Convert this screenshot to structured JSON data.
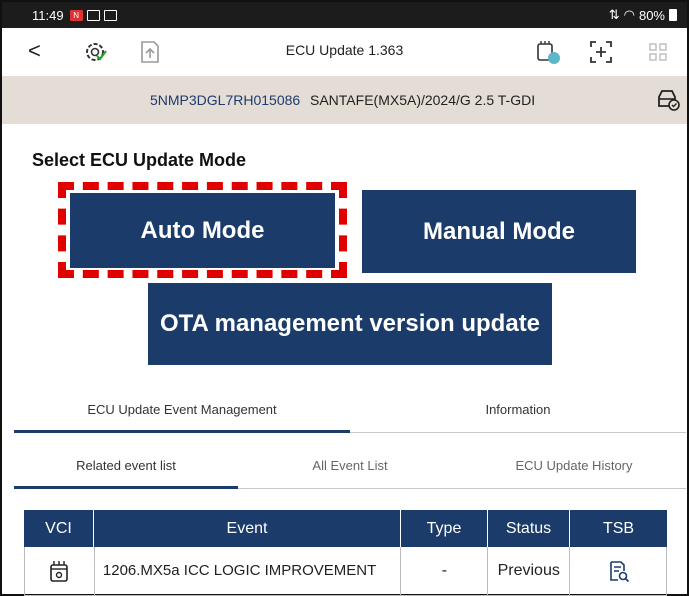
{
  "status_bar": {
    "time": "11:49",
    "battery": "80%"
  },
  "app_bar": {
    "back_icon": "chevron-left-icon",
    "title": "ECU Update 1.363"
  },
  "vehicle": {
    "vin": "5NMP3DGL7RH015086",
    "info": "SANTAFE(MX5A)/2024/G 2.5 T-GDI"
  },
  "section_title": "Select ECU Update Mode",
  "modes": {
    "auto": "Auto Mode",
    "manual": "Manual Mode",
    "ota": "OTA management version update"
  },
  "main_tabs": [
    {
      "label": "ECU Update Event Management",
      "active": true
    },
    {
      "label": "Information",
      "active": false
    }
  ],
  "sub_tabs": [
    {
      "label": "Related event list",
      "active": true
    },
    {
      "label": "All Event List",
      "active": false
    },
    {
      "label": "ECU Update History",
      "active": false
    }
  ],
  "table": {
    "headers": [
      "VCI",
      "Event",
      "Type",
      "Status",
      "TSB"
    ],
    "rows": [
      {
        "vci_icon": "vci-device-icon",
        "event": "1206.MX5a ICC LOGIC IMPROVEMENT",
        "type": "-",
        "status": "Previous",
        "tsb_icon": "document-search-icon"
      }
    ]
  },
  "colors": {
    "primary": "#1b3b6b",
    "highlight": "#e00000",
    "vehicle_bar": "#e4ddd5"
  }
}
